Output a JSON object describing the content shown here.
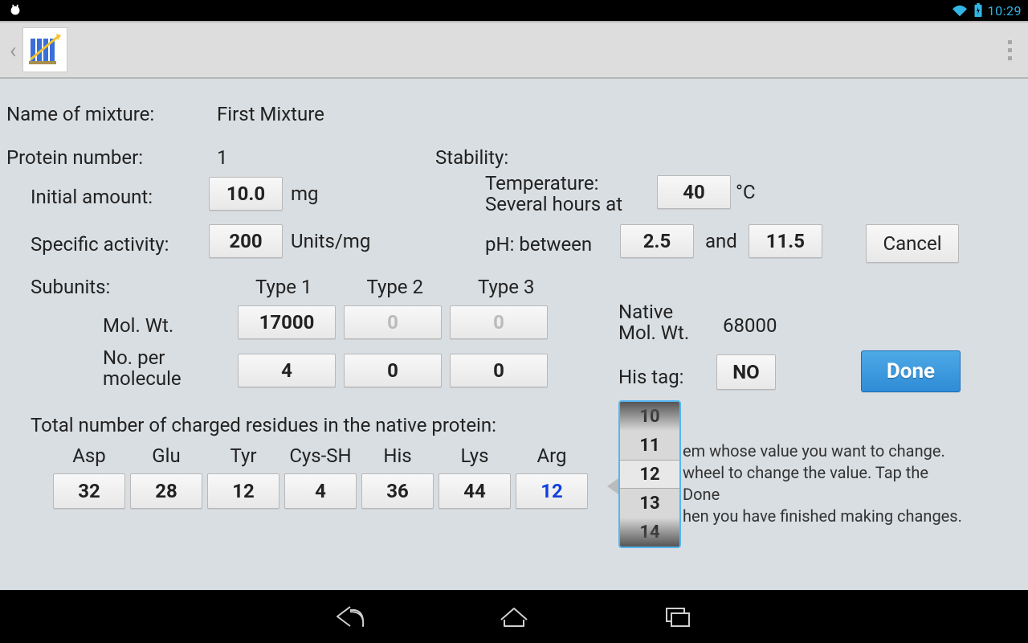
{
  "status": {
    "time": "10:29"
  },
  "labels": {
    "name_of_mixture": "Name of mixture:",
    "protein_number": "Protein number:",
    "initial_amount": "Initial amount:",
    "specific_activity": "Specific activity:",
    "subunits": "Subunits:",
    "type1": "Type 1",
    "type2": "Type 2",
    "type3": "Type 3",
    "mol_wt": "Mol. Wt.",
    "no_per_molecule": "No. per\nmolecule",
    "stability": "Stability:",
    "temperature": "Temperature:",
    "several_hours_at": "Several hours at",
    "ph_between": "pH: between",
    "and": "and",
    "native_mol_wt": "Native\nMol. Wt.",
    "his_tag": "His tag:",
    "cancel": "Cancel",
    "done": "Done",
    "total_residues": "Total number of charged residues in the native protein:",
    "deg_c": "°C",
    "mg": "mg",
    "units_mg": "Units/mg"
  },
  "values": {
    "mixture_name": "First Mixture",
    "protein_number": "1",
    "initial_amount": "10.0",
    "specific_activity": "200",
    "temperature": "40",
    "ph_low": "2.5",
    "ph_high": "11.5",
    "native_mol_wt": "68000",
    "his_tag": "NO",
    "subunits": {
      "mw": {
        "t1": "17000",
        "t2": "0",
        "t3": "0"
      },
      "num": {
        "t1": "4",
        "t2": "0",
        "t3": "0"
      }
    }
  },
  "residues": {
    "Asp": "32",
    "Glu": "28",
    "Tyr": "12",
    "Cys-SH": "4",
    "His": "36",
    "Lys": "44",
    "Arg": "12"
  },
  "picker": {
    "items": [
      "10",
      "11",
      "12",
      "13",
      "14"
    ],
    "selected": "12"
  },
  "help_text": "em whose value you want to change.\nwheel to change the value. Tap the Done\nhen you have finished making changes."
}
